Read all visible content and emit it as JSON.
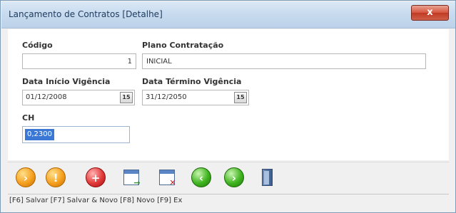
{
  "window": {
    "title": "Lançamento de Contratos [Detalhe]",
    "close_label": "x"
  },
  "form": {
    "codigo": {
      "label": "Código",
      "value": "1"
    },
    "plano": {
      "label": "Plano Contratação",
      "value": "INICIAL"
    },
    "data_inicio": {
      "label": "Data Início Vigência",
      "value": "01/12/2008",
      "cal_label": "15"
    },
    "data_termino": {
      "label": "Data Término Vigência",
      "value": "31/12/2050",
      "cal_label": "15"
    },
    "ch": {
      "label": "CH",
      "value": "0,2300"
    }
  },
  "toolbar": {
    "buttons": [
      {
        "name": "salvar",
        "icon": "orange-circle-arrow-icon",
        "glyph": "›"
      },
      {
        "name": "salvar-novo",
        "icon": "orange-circle-down-icon",
        "glyph": "!"
      },
      {
        "name": "novo",
        "icon": "red-circle-add-icon",
        "glyph": "+"
      },
      {
        "name": "export",
        "icon": "document-arrow-icon",
        "glyph": "→"
      },
      {
        "name": "excluir",
        "icon": "document-delete-icon",
        "glyph": "✕"
      },
      {
        "name": "anterior",
        "icon": "green-circle-left-icon",
        "glyph": "‹"
      },
      {
        "name": "proximo",
        "icon": "green-circle-right-icon",
        "glyph": "›"
      },
      {
        "name": "sair",
        "icon": "exit-door-icon",
        "glyph": ""
      }
    ]
  },
  "status": {
    "text": "[F6] Salvar [F7] Salvar & Novo [F8] Novo [F9] Ex"
  },
  "colors": {
    "selection": "#3b78d6",
    "title_bg": "#c8dbef",
    "close_red": "#d6533c"
  }
}
